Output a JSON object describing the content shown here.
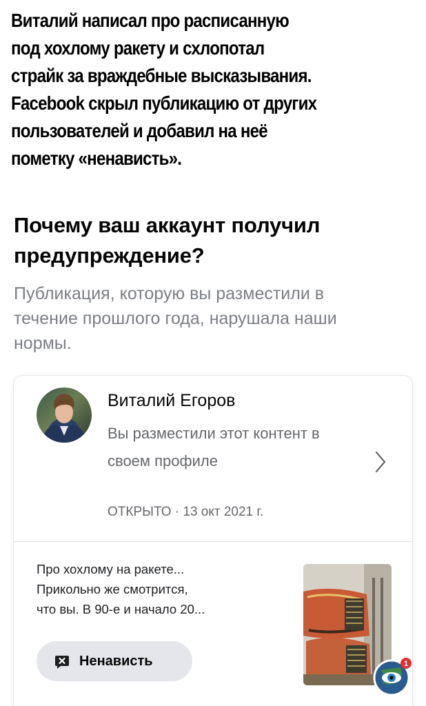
{
  "caption": {
    "lines": [
      "Виталий написал про расписанную",
      "под хохлому ракету и схлопотал",
      "страйк за враждебные высказывания.",
      "Facebook скрыл публикацию от других",
      "пользователей и добавил на неё",
      "пометку «ненависть»."
    ]
  },
  "warning": {
    "heading": "Почему ваш аккаунт получил предупреждение?",
    "subheading": "Публикация, которую вы разместили в течение прошлого года, нарушала наши нормы."
  },
  "post": {
    "author_name": "Виталий Егоров",
    "posted_where": "Вы разместили этот контент в своем профиле",
    "status": "ОТКРЫТО",
    "separator": "·",
    "date": "13 окт 2021 г.",
    "snippet_lines": [
      "Про хохлому на ракете...",
      "Прикольно же смотрится,",
      "что вы. В 90-е и начало 20..."
    ],
    "violation_tag": "Ненависть"
  },
  "icons": {
    "chevron": "chevron-right-icon",
    "tag": "speech-bubble-x-icon",
    "watermark": "eye-globe-logo",
    "watermark_badge": "1"
  },
  "colors": {
    "heading": "#050505",
    "secondary_text": "#65676b",
    "tag_background": "#e4e6eb"
  }
}
